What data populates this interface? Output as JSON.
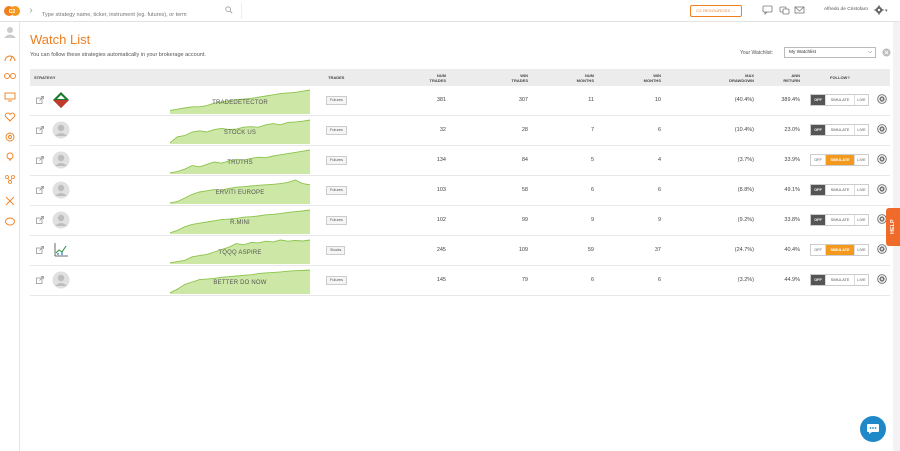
{
  "topbar": {
    "search_placeholder": "Type strategy name, ticker, instrument (eg. futures), or term",
    "resources_label": "C2 RESOURCES →",
    "user_name": "Alfredo de Cristofaro"
  },
  "page": {
    "title": "Watch List",
    "subtitle": "You can follow these strategies automatically in your brokerage account.",
    "watchlist_label": "Your Watchlist:",
    "watchlist_selected": "My Watchlist"
  },
  "table": {
    "headers": {
      "strategy": "STRATEGY",
      "trades": "TRADES",
      "num_trades": [
        "NUM",
        "TRADES"
      ],
      "win_trades": [
        "WIN",
        "TRADES"
      ],
      "num_months": [
        "NUM",
        "MONTHS"
      ],
      "win_months": [
        "WIN",
        "MONTHS"
      ],
      "max_drawdown": [
        "MAX",
        "DRAWDOWN"
      ],
      "ann_return": [
        "ANN",
        "RETURN"
      ],
      "follow": "FOLLOW?"
    },
    "follow_labels": {
      "off": "OFF",
      "simulate": "SIMULATE",
      "live": "LIVE"
    },
    "rows": [
      {
        "name": "TRADEDETECTOR",
        "type": "Futures",
        "num_trades": "381",
        "win_trades": "307",
        "num_months": "11",
        "win_months": "10",
        "max_drawdown": "(40.4%)",
        "ann_return": "389.4%",
        "follow": "off",
        "avatar": "logo",
        "equity": [
          0.15,
          0.2,
          0.25,
          0.3,
          0.3,
          0.35,
          0.45,
          0.5,
          0.55,
          0.6,
          0.62,
          0.65,
          0.7,
          0.75,
          0.8,
          0.85,
          0.88,
          0.9,
          0.95,
          1.0
        ]
      },
      {
        "name": "STOCK US",
        "type": "Futures",
        "num_trades": "32",
        "win_trades": "28",
        "num_months": "7",
        "win_months": "6",
        "max_drawdown": "(10.4%)",
        "ann_return": "23.0%",
        "follow": "off",
        "avatar": "person",
        "equity": [
          0.05,
          0.3,
          0.35,
          0.5,
          0.55,
          0.5,
          0.6,
          0.65,
          0.6,
          0.62,
          0.7,
          0.72,
          0.7,
          0.8,
          0.85,
          0.8,
          0.9,
          0.92,
          0.95,
          1.0
        ]
      },
      {
        "name": "TRUTHS",
        "type": "Futures",
        "num_trades": "134",
        "win_trades": "84",
        "num_months": "5",
        "win_months": "4",
        "max_drawdown": "(3.7%)",
        "ann_return": "33.9%",
        "follow": "simulate",
        "avatar": "person",
        "equity": [
          0.05,
          0.1,
          0.2,
          0.35,
          0.3,
          0.4,
          0.5,
          0.45,
          0.55,
          0.6,
          0.58,
          0.65,
          0.7,
          0.68,
          0.75,
          0.8,
          0.85,
          0.9,
          0.95,
          1.0
        ]
      },
      {
        "name": "ERVITI EUROPE",
        "type": "Futures",
        "num_trades": "103",
        "win_trades": "58",
        "num_months": "6",
        "win_months": "6",
        "max_drawdown": "(8.8%)",
        "ann_return": "49.1%",
        "follow": "off",
        "avatar": "person",
        "equity": [
          0.05,
          0.1,
          0.25,
          0.4,
          0.5,
          0.55,
          0.6,
          0.58,
          0.65,
          0.7,
          0.72,
          0.75,
          0.78,
          0.8,
          0.82,
          0.85,
          0.9,
          1.0,
          0.85,
          0.8
        ]
      },
      {
        "name": "R.MINI",
        "type": "Futures",
        "num_trades": "102",
        "win_trades": "99",
        "num_months": "9",
        "win_months": "9",
        "max_drawdown": "(9.2%)",
        "ann_return": "33.8%",
        "follow": "off",
        "avatar": "person",
        "equity": [
          0.05,
          0.15,
          0.3,
          0.4,
          0.45,
          0.5,
          0.55,
          0.6,
          0.62,
          0.65,
          0.7,
          0.72,
          0.75,
          0.8,
          0.82,
          0.85,
          0.9,
          0.93,
          0.96,
          1.0
        ]
      },
      {
        "name": "TQQQ ASPIRE",
        "type": "Stocks",
        "num_trades": "245",
        "win_trades": "109",
        "num_months": "59",
        "win_months": "37",
        "max_drawdown": "(24.7%)",
        "ann_return": "40.4%",
        "follow": "simulate",
        "avatar": "chart",
        "equity": [
          0.05,
          0.1,
          0.15,
          0.3,
          0.35,
          0.4,
          0.5,
          0.6,
          0.7,
          0.85,
          0.8,
          0.9,
          0.88,
          0.95,
          0.92,
          1.0,
          0.95,
          0.98,
          0.96,
          1.0
        ]
      },
      {
        "name": "BETTER DO NOW",
        "type": "Futures",
        "num_trades": "145",
        "win_trades": "79",
        "num_months": "6",
        "win_months": "6",
        "max_drawdown": "(3.2%)",
        "ann_return": "44.9%",
        "follow": "off",
        "avatar": "person",
        "equity": [
          0.05,
          0.2,
          0.4,
          0.5,
          0.6,
          0.62,
          0.65,
          0.7,
          0.72,
          0.75,
          0.78,
          0.8,
          0.85,
          0.88,
          0.9,
          0.92,
          0.95,
          0.97,
          0.98,
          1.0
        ]
      }
    ]
  },
  "help_label": "HELP",
  "colors": {
    "accent": "#f07f20",
    "simulate_active": "#f39a1e",
    "off_active": "#555555",
    "chart_green": "#8bc34a",
    "chat_blue": "#1e88c8"
  }
}
